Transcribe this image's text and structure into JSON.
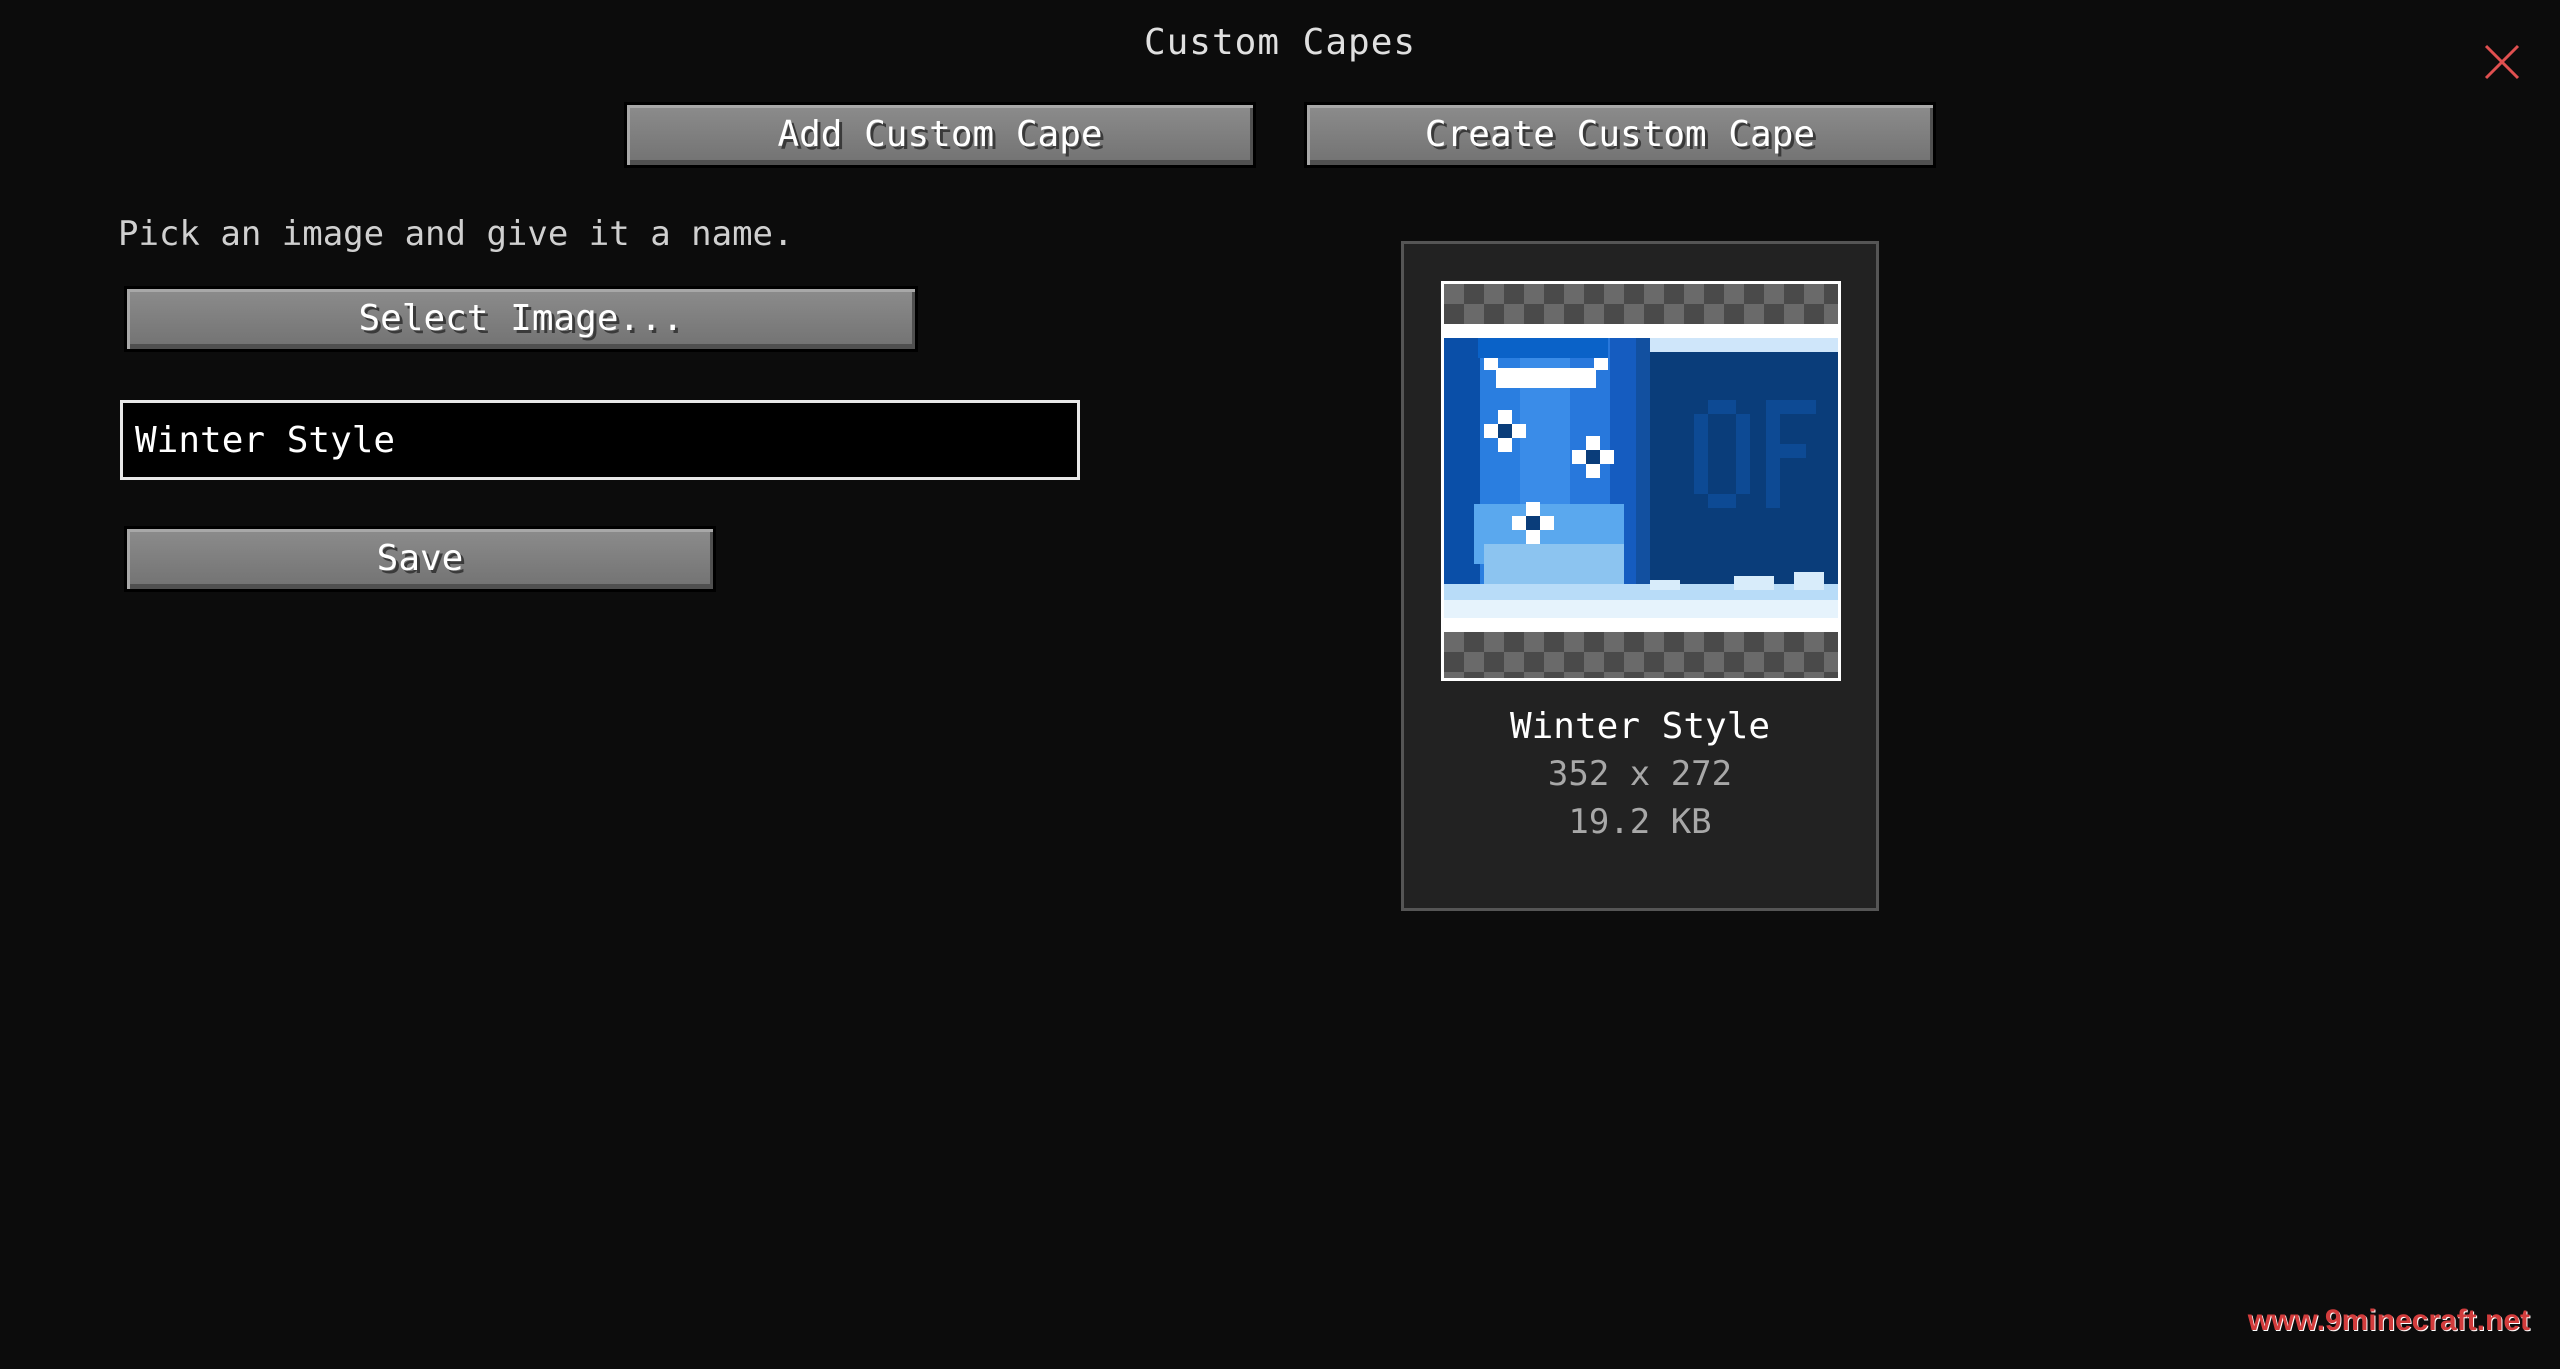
{
  "screen": {
    "title": "Custom Capes"
  },
  "toolbar": {
    "add_label": "Add Custom Cape",
    "create_label": "Create Custom Cape"
  },
  "form": {
    "instruction": "Pick an image and give it a name.",
    "select_image_label": "Select Image...",
    "name_value": "Winter Style",
    "save_label": "Save"
  },
  "preview": {
    "name": "Winter Style",
    "dimensions": "352 x 272",
    "file_size": "19.2 KB"
  },
  "watermark": {
    "text": "www.9minecraft.net"
  },
  "icons": {
    "close": "close-icon"
  },
  "colors": {
    "background": "#0c0c0c",
    "button_face": "#7f7f7f",
    "close_icon": "#e05050",
    "cape_dark_blue": "#0a3d7a",
    "cape_mid_blue": "#1e6ad2",
    "cape_light_blue": "#8cc4f0",
    "watermark": "#d23c3c"
  }
}
